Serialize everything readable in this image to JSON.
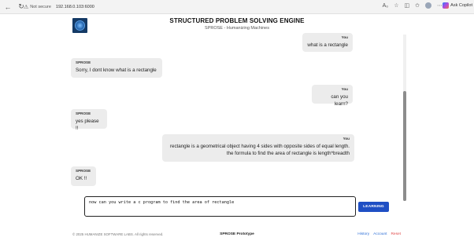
{
  "browser": {
    "security_label": "Not secure",
    "url": "192.168.0.103:6000",
    "copilot_label": "Ask Copilot"
  },
  "header": {
    "title": "STRUCTURED PROBLEM SOLVING ENGINE",
    "subtitle": "SPROSE - Humanizing Machines"
  },
  "messages": [
    {
      "sender": "You",
      "text": "what is a rectangle",
      "role": "user"
    },
    {
      "sender": "SPROSE",
      "text": "Sorry, I dont know what is a rectangle",
      "role": "bot"
    },
    {
      "sender": "You",
      "text": "can you learn?",
      "role": "user"
    },
    {
      "sender": "SPROSE",
      "text": "yes please !!",
      "role": "bot"
    },
    {
      "sender": "You",
      "text": "rectangle is a geometrical object having 4 sides with opposite sides of equal length.",
      "text2": "the formula to find the area of rectangle is length*breadth",
      "role": "user"
    },
    {
      "sender": "SPROSE",
      "text": "OK !!",
      "role": "bot"
    }
  ],
  "input": {
    "value": "now can you write a c program to find the area of rectangle"
  },
  "learn_button": "LEARNING",
  "footer": {
    "copyright": "© 2025 HUMANIZE SOFTWARE LABS. All rights reserved.",
    "center": "SPROSE Prototype",
    "history": "History",
    "account": "Account",
    "reset": "Reset"
  }
}
